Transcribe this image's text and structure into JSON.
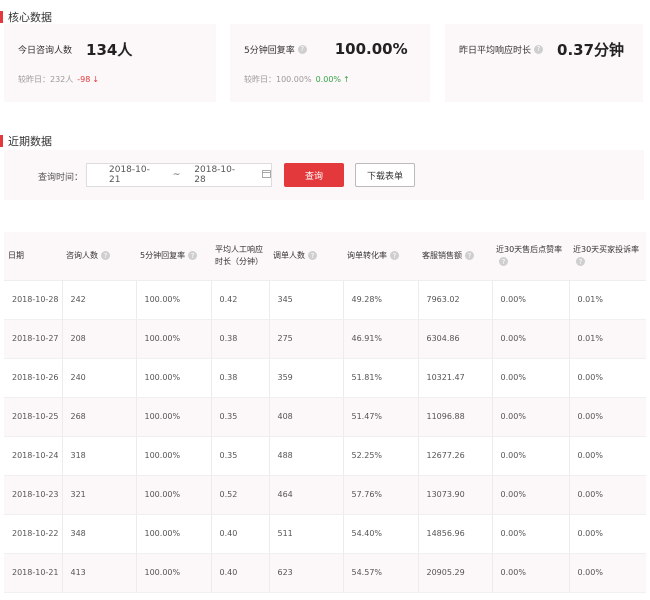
{
  "core": {
    "title": "核心数据",
    "cards": [
      {
        "label": "今日咨询人数",
        "value": "134人",
        "compare_label": "较昨日：232人",
        "delta": "-98",
        "delta_icon": "arrow-down-icon"
      },
      {
        "label": "5分钟回复率",
        "value": "100.00%",
        "compare_label": "较昨日：100.00%",
        "delta": "0.00%",
        "delta_icon": "arrow-up-icon"
      },
      {
        "label": "昨日平均响应时长",
        "value": "0.37分钟"
      }
    ]
  },
  "recent": {
    "title": "近期数据",
    "query_label": "查询时间：",
    "date_start": "2018-10-21",
    "date_sep": "~",
    "date_end": "2018-10-28",
    "query_button": "查询",
    "download_button": "下载表单"
  },
  "table": {
    "headers": [
      "日期",
      "咨询人数",
      "5分钟回复率",
      "平均人工响应时长（分钟）",
      "调单人数",
      "询单转化率",
      "客服销售额",
      "近30天售后点赞率",
      "近30天买家投诉率"
    ],
    "header_help": [
      false,
      true,
      true,
      false,
      true,
      true,
      true,
      true,
      true
    ],
    "rows": [
      [
        "2018-10-28",
        "242",
        "100.00%",
        "0.42",
        "345",
        "49.28%",
        "7963.02",
        "0.00%",
        "0.01%"
      ],
      [
        "2018-10-27",
        "208",
        "100.00%",
        "0.38",
        "275",
        "46.91%",
        "6304.86",
        "0.00%",
        "0.01%"
      ],
      [
        "2018-10-26",
        "240",
        "100.00%",
        "0.38",
        "359",
        "51.81%",
        "10321.47",
        "0.00%",
        "0.00%"
      ],
      [
        "2018-10-25",
        "268",
        "100.00%",
        "0.35",
        "408",
        "51.47%",
        "11096.88",
        "0.00%",
        "0.00%"
      ],
      [
        "2018-10-24",
        "318",
        "100.00%",
        "0.35",
        "488",
        "52.25%",
        "12677.26",
        "0.00%",
        "0.00%"
      ],
      [
        "2018-10-23",
        "321",
        "100.00%",
        "0.52",
        "464",
        "57.76%",
        "13073.90",
        "0.00%",
        "0.00%"
      ],
      [
        "2018-10-22",
        "348",
        "100.00%",
        "0.40",
        "511",
        "54.40%",
        "14856.96",
        "0.00%",
        "0.00%"
      ],
      [
        "2018-10-21",
        "413",
        "100.00%",
        "0.40",
        "623",
        "54.57%",
        "20905.29",
        "0.00%",
        "0.00%"
      ]
    ]
  },
  "colors": {
    "accent": "#e4393c",
    "panel_bg": "#fcf7f8",
    "up": "#3aa54a",
    "down": "#e4393c"
  }
}
